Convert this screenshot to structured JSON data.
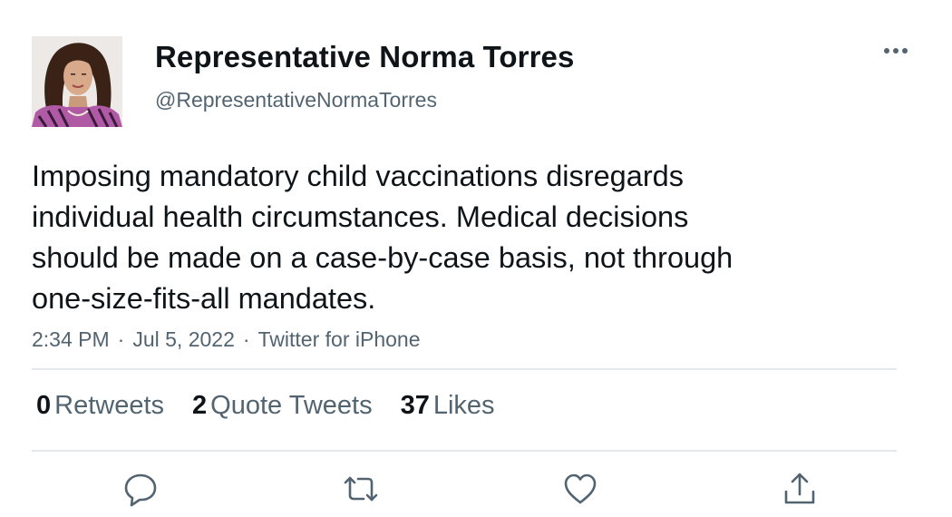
{
  "author": {
    "display_name": "Representative Norma Torres",
    "handle": "@RepresentativeNormaTorres"
  },
  "tweet": {
    "text_lines": [
      "Imposing mandatory child vaccinations disregards",
      "individual health circumstances. Medical decisions",
      "should be made on a case-by-case basis, not through",
      "one-size-fits-all mandates."
    ],
    "time": "2:34 PM",
    "date": "Jul 5, 2022",
    "source": "Twitter for iPhone",
    "separator": "·"
  },
  "stats": {
    "retweets_count": "0",
    "retweets_label": "Retweets",
    "quotes_count": "2",
    "quotes_label": "Quote Tweets",
    "likes_count": "37",
    "likes_label": "Likes"
  },
  "icons": {
    "more": "more-icon",
    "reply": "reply-icon",
    "retweet": "retweet-icon",
    "like": "like-icon",
    "share": "share-icon"
  },
  "colors": {
    "text": "#0f1419",
    "secondary": "#536471",
    "divider": "#e4e8eb",
    "action_icon": "#536471"
  }
}
